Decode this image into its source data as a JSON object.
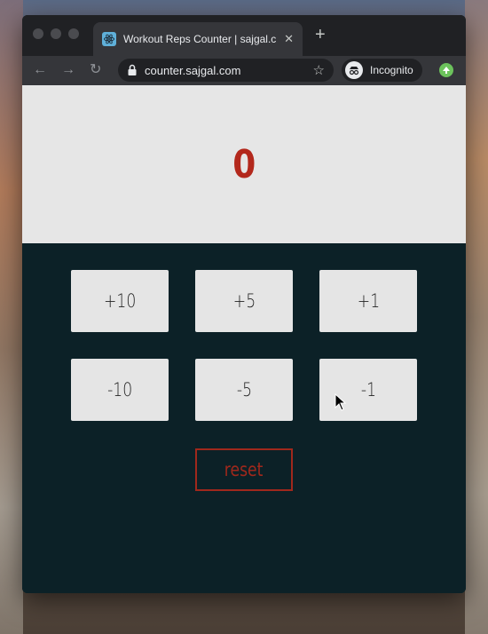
{
  "browser": {
    "tab_title": "Workout Reps Counter | sajgal.c",
    "url": "counter.sajgal.com",
    "incognito_label": "Incognito",
    "new_tab_label": "+",
    "close_tab_label": "✕"
  },
  "counter": {
    "value": "0",
    "value_color": "#b3281c"
  },
  "buttons": {
    "plus10": "+10",
    "plus5": "+5",
    "plus1": "+1",
    "minus10": "-10",
    "minus5": "-5",
    "minus1": "-1",
    "reset": "reset"
  },
  "colors": {
    "background": "#0c2127",
    "display_bg": "#e6e6e6",
    "button_bg": "#e5e5e5",
    "accent": "#a0281c"
  }
}
